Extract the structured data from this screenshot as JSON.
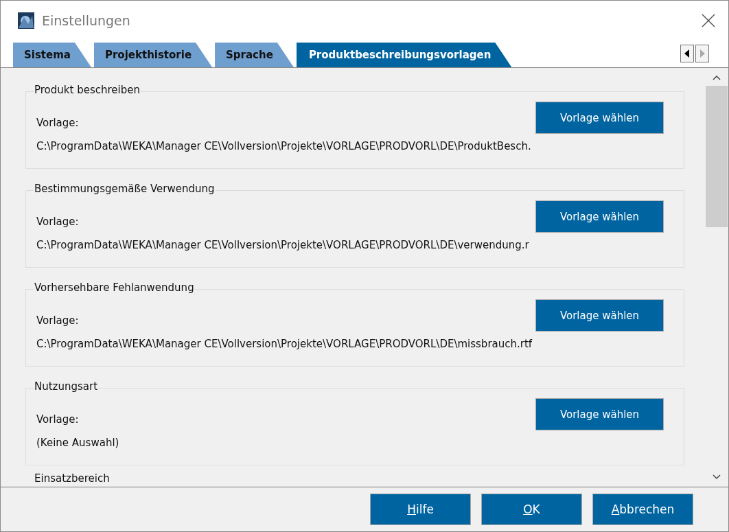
{
  "window": {
    "title": "Einstellungen"
  },
  "tabs": [
    {
      "label": "Sistema",
      "selected": false
    },
    {
      "label": "Projekthistorie",
      "selected": false
    },
    {
      "label": "Sprache",
      "selected": false
    },
    {
      "label": "Produktbeschreibungsvorlagen",
      "selected": true
    }
  ],
  "groups": [
    {
      "title": "Produkt beschreiben",
      "label": "Vorlage:",
      "path": "C:\\ProgramData\\WEKA\\Manager CE\\Vollversion\\Projekte\\VORLAGE\\PRODVORL\\DE\\ProduktBesch.",
      "button": "Vorlage wählen"
    },
    {
      "title": "Bestimmungsgemäße Verwendung",
      "label": "Vorlage:",
      "path": "C:\\ProgramData\\WEKA\\Manager CE\\Vollversion\\Projekte\\VORLAGE\\PRODVORL\\DE\\verwendung.r",
      "button": "Vorlage wählen"
    },
    {
      "title": "Vorhersehbare Fehlanwendung",
      "label": "Vorlage:",
      "path": "C:\\ProgramData\\WEKA\\Manager CE\\Vollversion\\Projekte\\VORLAGE\\PRODVORL\\DE\\missbrauch.rtf",
      "button": "Vorlage wählen"
    },
    {
      "title": "Nutzungsart",
      "label": "Vorlage:",
      "path": "(Keine Auswahl)",
      "button": "Vorlage wählen"
    }
  ],
  "next_group": {
    "title": "Einsatzbereich"
  },
  "buttons": [
    {
      "label": "Hilfe"
    },
    {
      "label": "OK"
    },
    {
      "label": "Abbrechen"
    }
  ]
}
